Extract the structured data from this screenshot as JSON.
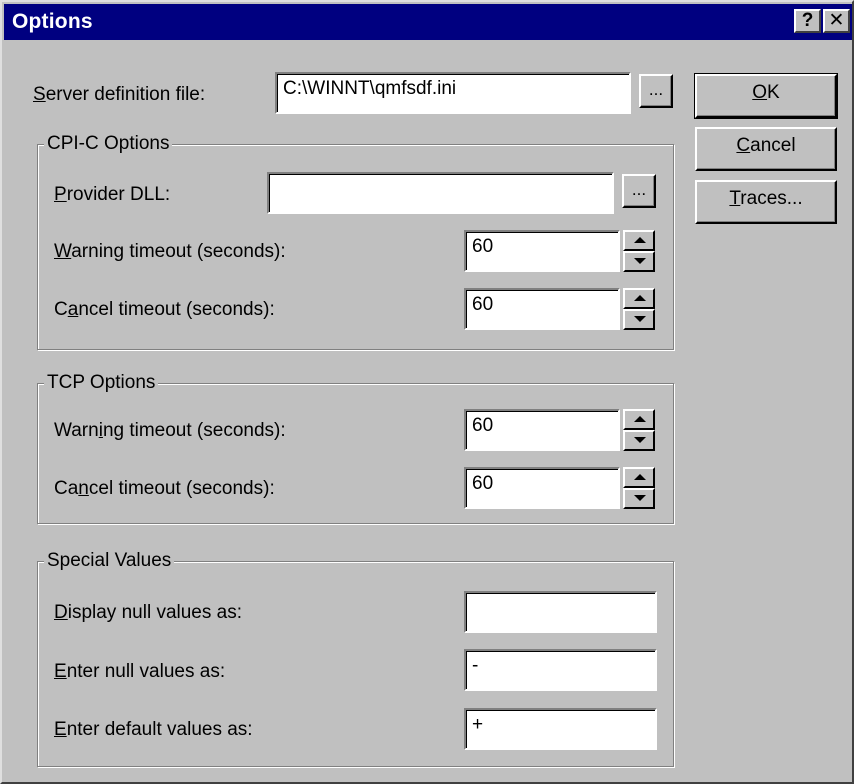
{
  "window": {
    "title": "Options",
    "help_button": "?",
    "close_button": "✕"
  },
  "server": {
    "label_hotkey": "S",
    "label_rest": "erver definition file:",
    "value": "C:\\WINNT\\qmfsdf.ini",
    "browse_label": "..."
  },
  "buttons": {
    "ok_hotkey": "O",
    "ok_rest": "K",
    "cancel_hotkey": "C",
    "cancel_rest": "ancel",
    "traces_hotkey": "T",
    "traces_rest": "races..."
  },
  "cpic": {
    "title": "CPI-C Options",
    "provider_hotkey": "P",
    "provider_rest": "rovider DLL:",
    "provider_value": "",
    "browse_label": "...",
    "warning_hotkey": "W",
    "warning_rest": "arning timeout (seconds):",
    "warning_value": "60",
    "cancel_pre": "C",
    "cancel_hotkey": "a",
    "cancel_rest": "ncel timeout (seconds):",
    "cancel_value": "60"
  },
  "tcp": {
    "title": "TCP Options",
    "warning_pre": "Warn",
    "warning_hotkey": "i",
    "warning_rest": "ng timeout (seconds):",
    "warning_value": "60",
    "cancel_pre": "Ca",
    "cancel_hotkey": "n",
    "cancel_rest": "cel timeout (seconds):",
    "cancel_value": "60"
  },
  "special": {
    "title": "Special Values",
    "display_hotkey": "D",
    "display_rest": "isplay null values as:",
    "display_value": "",
    "enter_null_hotkey": "E",
    "enter_null_rest": "nter null values as:",
    "enter_null_value": "-",
    "enter_default_hotkey": "E",
    "enter_default_rest": "nter default values as:",
    "enter_default_value": "+"
  },
  "colors": {
    "titlebar": "#000080",
    "dialog_face": "#c0c0c0",
    "field_bg": "#ffffff"
  }
}
